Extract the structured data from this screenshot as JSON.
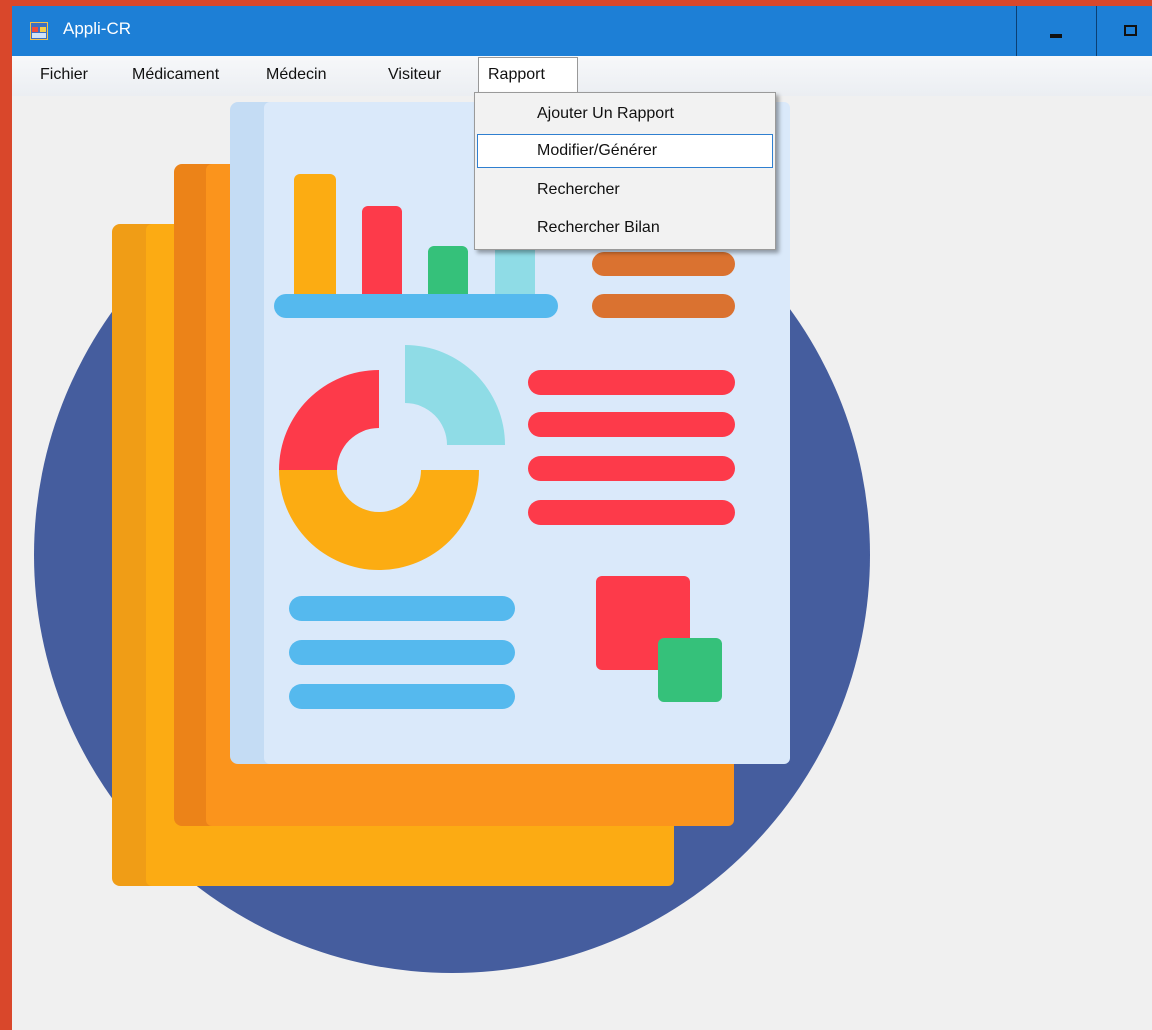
{
  "window": {
    "title": "Appli-CR",
    "icon": "app-window-icon"
  },
  "title_buttons": [
    {
      "name": "minimize",
      "icon": "minimize-icon"
    },
    {
      "name": "maximize",
      "icon": "maximize-icon"
    }
  ],
  "menubar": {
    "items": [
      "Fichier",
      "Médicament",
      "Médecin",
      "Visiteur",
      "Rapport"
    ],
    "open_item": "Rapport"
  },
  "dropdown": {
    "items": [
      "Ajouter Un Rapport",
      "Modifier/Générer",
      "Rechercher",
      "Rechercher Bilan"
    ],
    "highlighted": "Modifier/Générer"
  },
  "background_image": {
    "icon": "report-document-illustration"
  },
  "colors": {
    "titlebar": "#1d7fd6",
    "outer_border": "#d9472b",
    "circle": "#455d9e",
    "page": "#d9e9fa",
    "orange": "#fca713",
    "red": "#fd3a4a",
    "green": "#35c17a",
    "light_blue": "#55b9ee",
    "cyan": "#8fdce6",
    "brown": "#da7230"
  }
}
